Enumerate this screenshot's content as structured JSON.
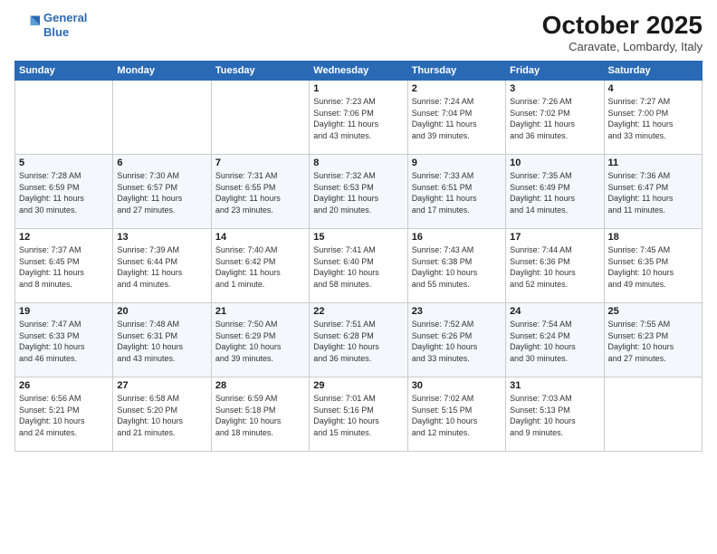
{
  "header": {
    "logo_line1": "General",
    "logo_line2": "Blue",
    "month": "October 2025",
    "location": "Caravate, Lombardy, Italy"
  },
  "weekdays": [
    "Sunday",
    "Monday",
    "Tuesday",
    "Wednesday",
    "Thursday",
    "Friday",
    "Saturday"
  ],
  "weeks": [
    [
      {
        "day": "",
        "info": ""
      },
      {
        "day": "",
        "info": ""
      },
      {
        "day": "",
        "info": ""
      },
      {
        "day": "1",
        "info": "Sunrise: 7:23 AM\nSunset: 7:06 PM\nDaylight: 11 hours\nand 43 minutes."
      },
      {
        "day": "2",
        "info": "Sunrise: 7:24 AM\nSunset: 7:04 PM\nDaylight: 11 hours\nand 39 minutes."
      },
      {
        "day": "3",
        "info": "Sunrise: 7:26 AM\nSunset: 7:02 PM\nDaylight: 11 hours\nand 36 minutes."
      },
      {
        "day": "4",
        "info": "Sunrise: 7:27 AM\nSunset: 7:00 PM\nDaylight: 11 hours\nand 33 minutes."
      }
    ],
    [
      {
        "day": "5",
        "info": "Sunrise: 7:28 AM\nSunset: 6:59 PM\nDaylight: 11 hours\nand 30 minutes."
      },
      {
        "day": "6",
        "info": "Sunrise: 7:30 AM\nSunset: 6:57 PM\nDaylight: 11 hours\nand 27 minutes."
      },
      {
        "day": "7",
        "info": "Sunrise: 7:31 AM\nSunset: 6:55 PM\nDaylight: 11 hours\nand 23 minutes."
      },
      {
        "day": "8",
        "info": "Sunrise: 7:32 AM\nSunset: 6:53 PM\nDaylight: 11 hours\nand 20 minutes."
      },
      {
        "day": "9",
        "info": "Sunrise: 7:33 AM\nSunset: 6:51 PM\nDaylight: 11 hours\nand 17 minutes."
      },
      {
        "day": "10",
        "info": "Sunrise: 7:35 AM\nSunset: 6:49 PM\nDaylight: 11 hours\nand 14 minutes."
      },
      {
        "day": "11",
        "info": "Sunrise: 7:36 AM\nSunset: 6:47 PM\nDaylight: 11 hours\nand 11 minutes."
      }
    ],
    [
      {
        "day": "12",
        "info": "Sunrise: 7:37 AM\nSunset: 6:45 PM\nDaylight: 11 hours\nand 8 minutes."
      },
      {
        "day": "13",
        "info": "Sunrise: 7:39 AM\nSunset: 6:44 PM\nDaylight: 11 hours\nand 4 minutes."
      },
      {
        "day": "14",
        "info": "Sunrise: 7:40 AM\nSunset: 6:42 PM\nDaylight: 11 hours\nand 1 minute."
      },
      {
        "day": "15",
        "info": "Sunrise: 7:41 AM\nSunset: 6:40 PM\nDaylight: 10 hours\nand 58 minutes."
      },
      {
        "day": "16",
        "info": "Sunrise: 7:43 AM\nSunset: 6:38 PM\nDaylight: 10 hours\nand 55 minutes."
      },
      {
        "day": "17",
        "info": "Sunrise: 7:44 AM\nSunset: 6:36 PM\nDaylight: 10 hours\nand 52 minutes."
      },
      {
        "day": "18",
        "info": "Sunrise: 7:45 AM\nSunset: 6:35 PM\nDaylight: 10 hours\nand 49 minutes."
      }
    ],
    [
      {
        "day": "19",
        "info": "Sunrise: 7:47 AM\nSunset: 6:33 PM\nDaylight: 10 hours\nand 46 minutes."
      },
      {
        "day": "20",
        "info": "Sunrise: 7:48 AM\nSunset: 6:31 PM\nDaylight: 10 hours\nand 43 minutes."
      },
      {
        "day": "21",
        "info": "Sunrise: 7:50 AM\nSunset: 6:29 PM\nDaylight: 10 hours\nand 39 minutes."
      },
      {
        "day": "22",
        "info": "Sunrise: 7:51 AM\nSunset: 6:28 PM\nDaylight: 10 hours\nand 36 minutes."
      },
      {
        "day": "23",
        "info": "Sunrise: 7:52 AM\nSunset: 6:26 PM\nDaylight: 10 hours\nand 33 minutes."
      },
      {
        "day": "24",
        "info": "Sunrise: 7:54 AM\nSunset: 6:24 PM\nDaylight: 10 hours\nand 30 minutes."
      },
      {
        "day": "25",
        "info": "Sunrise: 7:55 AM\nSunset: 6:23 PM\nDaylight: 10 hours\nand 27 minutes."
      }
    ],
    [
      {
        "day": "26",
        "info": "Sunrise: 6:56 AM\nSunset: 5:21 PM\nDaylight: 10 hours\nand 24 minutes."
      },
      {
        "day": "27",
        "info": "Sunrise: 6:58 AM\nSunset: 5:20 PM\nDaylight: 10 hours\nand 21 minutes."
      },
      {
        "day": "28",
        "info": "Sunrise: 6:59 AM\nSunset: 5:18 PM\nDaylight: 10 hours\nand 18 minutes."
      },
      {
        "day": "29",
        "info": "Sunrise: 7:01 AM\nSunset: 5:16 PM\nDaylight: 10 hours\nand 15 minutes."
      },
      {
        "day": "30",
        "info": "Sunrise: 7:02 AM\nSunset: 5:15 PM\nDaylight: 10 hours\nand 12 minutes."
      },
      {
        "day": "31",
        "info": "Sunrise: 7:03 AM\nSunset: 5:13 PM\nDaylight: 10 hours\nand 9 minutes."
      },
      {
        "day": "",
        "info": ""
      }
    ]
  ]
}
